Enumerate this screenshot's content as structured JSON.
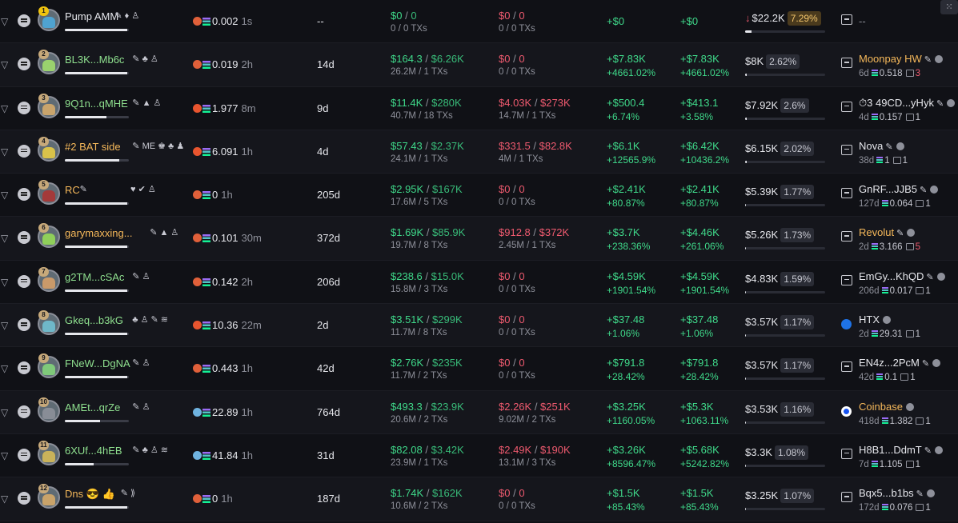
{
  "rows": [
    {
      "rank": "1",
      "name": "Pump AMM",
      "name_color": "purple",
      "icons": "✎ ♦ ♙",
      "progress": 0.98,
      "src_icon": "pill",
      "src_value": "0.002",
      "src_age": "1s",
      "holding": "--",
      "buy_usd": "$0",
      "buy_total": "0",
      "buy_sub": "0 / 0 TXs",
      "sell_usd": "$0",
      "sell_total": "0",
      "sell_sub": "0 / 0 TXs",
      "pnl_a": "+$0",
      "pnl_a2": "",
      "pnl_b": "+$0",
      "pnl_b2": "",
      "mc": "$22.2K",
      "mc_pct": "7.29%",
      "mc_warn": true,
      "mc_down": true,
      "mc_fill": 0.08,
      "fund_type": "icon",
      "fund_name": "--",
      "fund_name_style": "dash",
      "fund_age": "",
      "fund_sol": "",
      "fund_tx": "",
      "fund_tx_red": false,
      "fund_edit": false
    },
    {
      "rank": "2",
      "name": "BL3K...Mb6c",
      "name_color": "green",
      "icons": "✎ ♣ ♙",
      "progress": 0.98,
      "src_icon": "pill",
      "src_value": "0.019",
      "src_age": "2h",
      "holding": "14d",
      "buy_usd": "$164.3",
      "buy_total": "$6.26K",
      "buy_sub": "26.2M / 1 TXs",
      "sell_usd": "$0",
      "sell_total": "0",
      "sell_sub": "0 / 0 TXs",
      "pnl_a": "+$7.83K",
      "pnl_a2": "+4661.02%",
      "pnl_b": "+$7.83K",
      "pnl_b2": "+4661.02%",
      "mc": "$8K",
      "mc_pct": "2.62%",
      "mc_warn": false,
      "mc_down": false,
      "mc_fill": 0.02,
      "fund_type": "icon",
      "fund_name": "Moonpay HW",
      "fund_name_style": "orange",
      "fund_age": "6d",
      "fund_sol": "0.518",
      "fund_tx": "3",
      "fund_tx_red": true,
      "fund_edit": true
    },
    {
      "rank": "3",
      "name": "9Q1n...qMHE",
      "name_color": "green",
      "icons": "✎ ▲ ♙",
      "progress": 0.65,
      "src_icon": "ray",
      "src_value": "1.977",
      "src_age": "8m",
      "holding": "9d",
      "buy_usd": "$11.4K",
      "buy_total": "$280K",
      "buy_sub": "40.7M / 18 TXs",
      "sell_usd": "$4.03K",
      "sell_total": "$273K",
      "sell_sub": "14.7M / 1 TXs",
      "pnl_a": "+$500.4",
      "pnl_a2": "+6.74%",
      "pnl_b": "+$413.1",
      "pnl_b2": "+3.58%",
      "mc": "$7.92K",
      "mc_pct": "2.6%",
      "mc_warn": false,
      "mc_down": false,
      "mc_fill": 0.02,
      "fund_type": "icon",
      "fund_name": "⏱3 49CD...yHyk",
      "fund_name_style": "plain",
      "fund_age": "4d",
      "fund_sol": "0.157",
      "fund_tx": "1",
      "fund_tx_red": false,
      "fund_edit": true
    },
    {
      "rank": "4",
      "name": "#2 BAT side",
      "name_color": "orange",
      "icons": "✎ ME ♚ ♣ ♟",
      "progress": 0.85,
      "src_icon": "ray",
      "src_value": "6.091",
      "src_age": "1h",
      "holding": "4d",
      "buy_usd": "$57.43",
      "buy_total": "$2.37K",
      "buy_sub": "24.1M / 1 TXs",
      "sell_usd": "$331.5",
      "sell_total": "$82.8K",
      "sell_sub": "4M / 1 TXs",
      "pnl_a": "+$6.1K",
      "pnl_a2": "+12565.9%",
      "pnl_b": "+$6.42K",
      "pnl_b2": "+10436.2%",
      "mc": "$6.15K",
      "mc_pct": "2.02%",
      "mc_warn": false,
      "mc_down": false,
      "mc_fill": 0.02,
      "fund_type": "icon",
      "fund_name": "Nova",
      "fund_name_style": "plain",
      "fund_age": "38d",
      "fund_sol": "1",
      "fund_tx": "1",
      "fund_tx_red": false,
      "fund_edit": true
    },
    {
      "rank": "5",
      "name": "RC",
      "name_color": "orange",
      "icons": "✎",
      "icons2": "♥ ✔ ♙",
      "progress": 0.98,
      "src_icon": "pill",
      "src_value": "0",
      "src_age": "1h",
      "holding": "205d",
      "buy_usd": "$2.95K",
      "buy_total": "$167K",
      "buy_sub": "17.6M / 5 TXs",
      "sell_usd": "$0",
      "sell_total": "0",
      "sell_sub": "0 / 0 TXs",
      "pnl_a": "+$2.41K",
      "pnl_a2": "+80.87%",
      "pnl_b": "+$2.41K",
      "pnl_b2": "+80.87%",
      "mc": "$5.39K",
      "mc_pct": "1.77%",
      "mc_warn": false,
      "mc_down": false,
      "mc_fill": 0.01,
      "fund_type": "icon",
      "fund_name": "GnRF...JJB5",
      "fund_name_style": "plain",
      "fund_age": "127d",
      "fund_sol": "0.064",
      "fund_tx": "1",
      "fund_tx_red": false,
      "fund_edit": true
    },
    {
      "rank": "6",
      "name": "garymaxxing...",
      "name_color": "orange",
      "icons": "✎ ▲ ♙",
      "progress": 0.98,
      "src_icon": "pill",
      "src_value": "0.101",
      "src_age": "30m",
      "holding": "372d",
      "buy_usd": "$1.69K",
      "buy_total": "$85.9K",
      "buy_sub": "19.7M / 8 TXs",
      "sell_usd": "$912.8",
      "sell_total": "$372K",
      "sell_sub": "2.45M / 1 TXs",
      "pnl_a": "+$3.7K",
      "pnl_a2": "+238.36%",
      "pnl_b": "+$4.46K",
      "pnl_b2": "+261.06%",
      "mc": "$5.26K",
      "mc_pct": "1.73%",
      "mc_warn": false,
      "mc_down": false,
      "mc_fill": 0.01,
      "fund_type": "icon",
      "fund_name": "Revolut",
      "fund_name_style": "orange",
      "fund_age": "2d",
      "fund_sol": "3.166",
      "fund_tx": "5",
      "fund_tx_red": true,
      "fund_edit": true
    },
    {
      "rank": "7",
      "name": "g2TM...cSAc",
      "name_color": "green",
      "icons": "✎ ♙",
      "progress": 0.98,
      "src_icon": "pill",
      "src_value": "0.142",
      "src_age": "2h",
      "holding": "206d",
      "buy_usd": "$238.6",
      "buy_total": "$15.0K",
      "buy_sub": "15.8M / 3 TXs",
      "sell_usd": "$0",
      "sell_total": "0",
      "sell_sub": "0 / 0 TXs",
      "pnl_a": "+$4.59K",
      "pnl_a2": "+1901.54%",
      "pnl_b": "+$4.59K",
      "pnl_b2": "+1901.54%",
      "mc": "$4.83K",
      "mc_pct": "1.59%",
      "mc_warn": false,
      "mc_down": false,
      "mc_fill": 0.01,
      "fund_type": "icon",
      "fund_name": "EmGy...KhQD",
      "fund_name_style": "plain",
      "fund_age": "206d",
      "fund_sol": "0.017",
      "fund_tx": "1",
      "fund_tx_red": false,
      "fund_edit": true
    },
    {
      "rank": "8",
      "name": "Gkeq...b3kG",
      "name_color": "green",
      "icons": "♣ ♙ ✎ ≋",
      "progress": 0.98,
      "src_icon": "ray",
      "src_value": "10.36",
      "src_age": "22m",
      "holding": "2d",
      "buy_usd": "$3.51K",
      "buy_total": "$299K",
      "buy_sub": "11.7M / 8 TXs",
      "sell_usd": "$0",
      "sell_total": "0",
      "sell_sub": "0 / 0 TXs",
      "pnl_a": "+$37.48",
      "pnl_a2": "+1.06%",
      "pnl_b": "+$37.48",
      "pnl_b2": "+1.06%",
      "mc": "$3.57K",
      "mc_pct": "1.17%",
      "mc_warn": false,
      "mc_down": false,
      "mc_fill": 0.01,
      "fund_type": "htx",
      "fund_name": "HTX",
      "fund_name_style": "plain",
      "fund_age": "2d",
      "fund_sol": "29.31",
      "fund_tx": "1",
      "fund_tx_red": false,
      "fund_edit": false
    },
    {
      "rank": "9",
      "name": "FNeW...DgNA",
      "name_color": "green",
      "icons": "✎ ♙",
      "progress": 0.98,
      "src_icon": "pill",
      "src_value": "0.443",
      "src_age": "1h",
      "holding": "42d",
      "buy_usd": "$2.76K",
      "buy_total": "$235K",
      "buy_sub": "11.7M / 2 TXs",
      "sell_usd": "$0",
      "sell_total": "0",
      "sell_sub": "0 / 0 TXs",
      "pnl_a": "+$791.8",
      "pnl_a2": "+28.42%",
      "pnl_b": "+$791.8",
      "pnl_b2": "+28.42%",
      "mc": "$3.57K",
      "mc_pct": "1.17%",
      "mc_warn": false,
      "mc_down": false,
      "mc_fill": 0.01,
      "fund_type": "icon",
      "fund_name": "EN4z...2PcM",
      "fund_name_style": "plain",
      "fund_age": "42d",
      "fund_sol": "0.1",
      "fund_tx": "1",
      "fund_tx_red": false,
      "fund_edit": true
    },
    {
      "rank": "10",
      "name": "AMEt...qrZe",
      "name_color": "green",
      "icons": "✎ ♙",
      "progress": 0.55,
      "src_icon": "eye",
      "src_value": "22.89",
      "src_age": "1h",
      "holding": "764d",
      "buy_usd": "$493.3",
      "buy_total": "$23.9K",
      "buy_sub": "20.6M / 2 TXs",
      "sell_usd": "$2.26K",
      "sell_total": "$251K",
      "sell_sub": "9.02M / 2 TXs",
      "pnl_a": "+$3.25K",
      "pnl_a2": "+1160.05%",
      "pnl_b": "+$5.3K",
      "pnl_b2": "+1063.11%",
      "mc": "$3.53K",
      "mc_pct": "1.16%",
      "mc_warn": false,
      "mc_down": false,
      "mc_fill": 0.01,
      "fund_type": "coinbase",
      "fund_name": "Coinbase",
      "fund_name_style": "orange",
      "fund_age": "418d",
      "fund_sol": "1.382",
      "fund_tx": "1",
      "fund_tx_red": false,
      "fund_edit": false
    },
    {
      "rank": "11",
      "name": "6XUf...4hEB",
      "name_color": "green",
      "icons": "✎ ♣ ♙ ≋",
      "progress": 0.45,
      "src_icon": "eye",
      "src_value": "41.84",
      "src_age": "1h",
      "holding": "31d",
      "buy_usd": "$82.08",
      "buy_total": "$3.42K",
      "buy_sub": "23.9M / 1 TXs",
      "sell_usd": "$2.49K",
      "sell_total": "$190K",
      "sell_sub": "13.1M / 3 TXs",
      "pnl_a": "+$3.26K",
      "pnl_a2": "+8596.47%",
      "pnl_b": "+$5.68K",
      "pnl_b2": "+5242.82%",
      "mc": "$3.3K",
      "mc_pct": "1.08%",
      "mc_warn": false,
      "mc_down": false,
      "mc_fill": 0.01,
      "fund_type": "icon",
      "fund_name": "H8B1...DdmT",
      "fund_name_style": "plain",
      "fund_age": "7d",
      "fund_sol": "1.105",
      "fund_tx": "1",
      "fund_tx_red": false,
      "fund_edit": true
    },
    {
      "rank": "12",
      "name": "Dns 😎 👍",
      "name_color": "orange",
      "icons": "✎ ⟫",
      "progress": 0.98,
      "src_icon": "pill",
      "src_value": "0",
      "src_age": "1h",
      "holding": "187d",
      "buy_usd": "$1.74K",
      "buy_total": "$162K",
      "buy_sub": "10.6M / 2 TXs",
      "sell_usd": "$0",
      "sell_total": "0",
      "sell_sub": "0 / 0 TXs",
      "pnl_a": "+$1.5K",
      "pnl_a2": "+85.43%",
      "pnl_b": "+$1.5K",
      "pnl_b2": "+85.43%",
      "mc": "$3.25K",
      "mc_pct": "1.07%",
      "mc_warn": false,
      "mc_down": false,
      "mc_fill": 0.01,
      "fund_type": "icon",
      "fund_name": "Bqx5...b1bs",
      "fund_name_style": "plain",
      "fund_age": "172d",
      "fund_sol": "0.076",
      "fund_tx": "1",
      "fund_tx_red": false,
      "fund_edit": true
    }
  ],
  "colors": {
    "green": "#3fd98a",
    "red": "#ef5a6f",
    "orange": "#f5b85a",
    "bg": "#101116"
  },
  "avatar_colors": [
    "#4fa3d1",
    "#9ad16e",
    "#c9a46c",
    "#d9c24a",
    "#a33a3a",
    "#8fcf5a",
    "#c99a6a",
    "#6fb8c9",
    "#7fc97a",
    "#888d96",
    "#c9b25a",
    "#c9a36a"
  ],
  "corner_icon": "grid-icon"
}
